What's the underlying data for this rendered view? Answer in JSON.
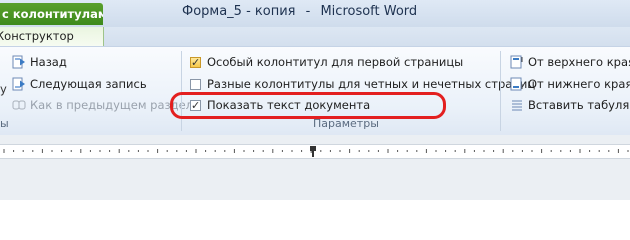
{
  "window": {
    "context_tab_label": "с колонтитулами",
    "doc_name": "Форма_5 - копия",
    "separator": "-",
    "app_name": "Microsoft Word"
  },
  "tabs": {
    "active_label": "Конструктор"
  },
  "navigation": {
    "back_label": "Назад",
    "next_label": "Следующая запись",
    "link_prev_label": "Как в предыдущем разделе",
    "partial_left_1": "у",
    "group_label_partial": "ы"
  },
  "options": {
    "items": [
      {
        "label": "Особый колонтитул для первой страницы",
        "checked": true
      },
      {
        "label": "Разные колонтитулы для четных и нечетных страниц",
        "checked": false
      },
      {
        "label": "Показать текст документа",
        "checked": true
      }
    ],
    "group_label": "Параметры"
  },
  "position": {
    "from_top_label": "От верхнего края д",
    "from_bottom_label": "От нижнего края д",
    "insert_tab_label": "Вставить табуляцию"
  },
  "colors": {
    "context_green": "#3d8a1b",
    "highlight_red": "#e31f1f"
  }
}
